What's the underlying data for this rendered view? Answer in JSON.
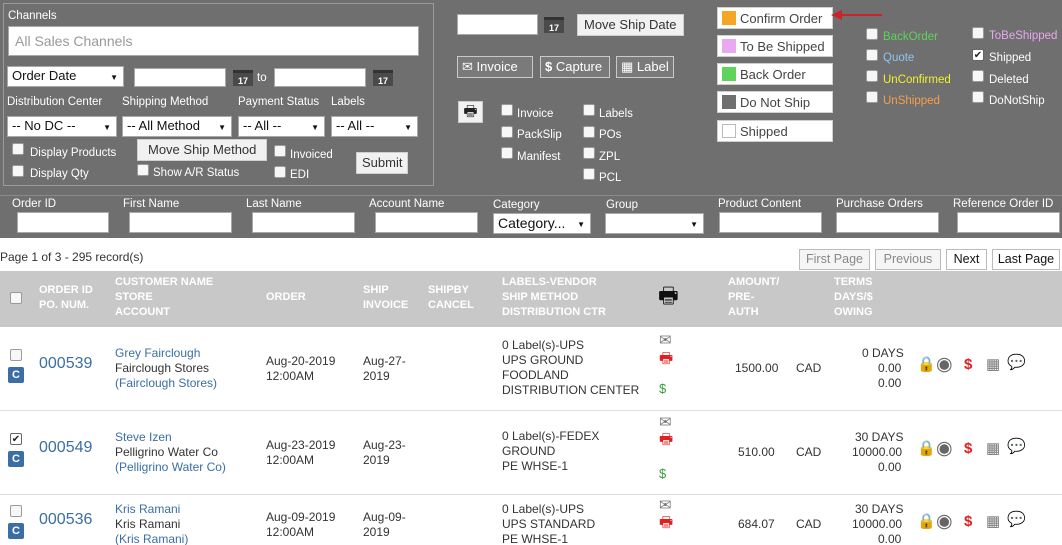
{
  "filters": {
    "channels_label": "Channels",
    "channels_placeholder": "All Sales Channels",
    "date_type": "Order Date",
    "cal_label": "17",
    "to_label": "to",
    "dc_label": "Distribution Center",
    "ship_label": "Shipping Method",
    "pay_label": "Payment Status",
    "labels_label": "Labels",
    "dc_value": "-- No DC --",
    "ship_value": "-- All Method",
    "pay_value": "-- All --",
    "labels_value": "-- All --",
    "display_products": "Display Products",
    "display_qty": "Display Qty",
    "move_ship_method": "Move Ship Method",
    "show_ar": "Show A/R Status",
    "invoiced": "Invoiced",
    "edi": "EDI",
    "submit": "Submit"
  },
  "actions": {
    "move_ship_date": "Move Ship Date",
    "invoice": "Invoice",
    "capture": "Capture",
    "label": "Label",
    "print_options": [
      "Invoice",
      "PackSlip",
      "Manifest",
      "Labels",
      "POs",
      "ZPL",
      "PCL"
    ]
  },
  "status_buttons": [
    {
      "label": "Confirm Order",
      "color": "#f5a623"
    },
    {
      "label": "To Be Shipped",
      "color": "#e9a8f0"
    },
    {
      "label": "Back Order",
      "color": "#5fd35a"
    },
    {
      "label": "Do Not Ship",
      "color": "#6f6f6f"
    },
    {
      "label": "Shipped",
      "color": "#ffffff"
    }
  ],
  "legend": {
    "backorder": "BackOrder",
    "quote": "Quote",
    "unconfirmed": "UnConfirmed",
    "unshipped": "UnShipped",
    "tobeshipped": "ToBeShipped",
    "shipped": "Shipped",
    "deleted": "Deleted",
    "donotship": "DoNotShip"
  },
  "search_columns": {
    "order_id": "Order ID",
    "first_name": "First Name",
    "last_name": "Last Name",
    "account_name": "Account Name",
    "category": "Category",
    "category_value": "Category...",
    "group": "Group",
    "product_content": "Product Content",
    "purchase_orders": "Purchase Orders",
    "reference_order_id": "Reference Order ID"
  },
  "pager": {
    "text": "Page  1  of  3  -  295  record(s)",
    "first": "First Page",
    "previous": "Previous",
    "next": "Next",
    "last": "Last Page"
  },
  "table_headers": {
    "order": [
      "ORDER ID",
      "PO. NUM."
    ],
    "customer": [
      "CUSTOMER NAME",
      "STORE",
      "ACCOUNT"
    ],
    "order_date": "ORDER",
    "ship": [
      "SHIP",
      "INVOICE"
    ],
    "shipby": [
      "SHIPBY",
      "CANCEL"
    ],
    "labels": [
      "LABELS-VENDOR",
      "SHIP METHOD",
      "DISTRIBUTION CTR"
    ],
    "amount": [
      "AMOUNT/",
      "PRE-",
      "AUTH"
    ],
    "terms": [
      "TERMS",
      "DAYS/$",
      "OWING"
    ]
  },
  "orders": [
    {
      "id": "000539",
      "checked": false,
      "customer": "Grey Fairclough",
      "store": "Fairclough Stores",
      "account": "(Fairclough Stores)",
      "order_date": "Aug-20-2019",
      "order_time": "12:00AM",
      "ship_date": "Aug-27-",
      "ship_year": "2019",
      "labels": [
        "0 Label(s)-UPS",
        "UPS GROUND",
        "FOODLAND",
        "DISTRIBUTION CENTER"
      ],
      "amount": "1500.00",
      "currency": "CAD",
      "terms": [
        "0 DAYS",
        "0.00",
        "0.00"
      ]
    },
    {
      "id": "000549",
      "checked": true,
      "customer": "Steve Izen",
      "store": "Pelligrino Water Co",
      "account": "(Pelligrino Water Co)",
      "order_date": "Aug-23-2019",
      "order_time": "12:00AM",
      "ship_date": "Aug-23-",
      "ship_year": "2019",
      "labels": [
        "0 Label(s)-FEDEX",
        "GROUND",
        "PE WHSE-1"
      ],
      "amount": "510.00",
      "currency": "CAD",
      "terms": [
        "30 DAYS",
        "10000.00",
        "0.00"
      ]
    },
    {
      "id": "000536",
      "checked": false,
      "customer": "Kris Ramani",
      "store": "Kris Ramani",
      "account": "(Kris Ramani)",
      "order_date": "Aug-09-2019",
      "order_time": "12:00AM",
      "ship_date": "Aug-09-",
      "ship_year": "2019",
      "labels": [
        "0 Label(s)-UPS",
        "UPS STANDARD",
        "PE WHSE-1"
      ],
      "amount": "684.07",
      "currency": "CAD",
      "terms": [
        "30 DAYS",
        "10000.00",
        "0.00"
      ]
    }
  ]
}
